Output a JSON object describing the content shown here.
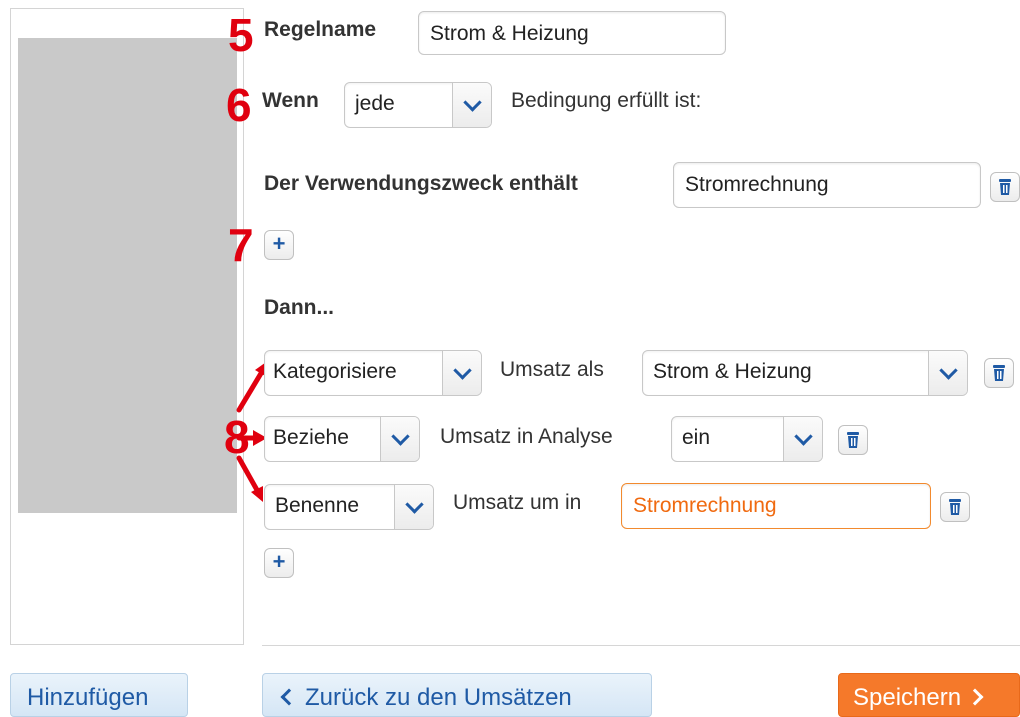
{
  "markers": {
    "m5": "5",
    "m6": "6",
    "m7": "7",
    "m8": "8"
  },
  "rule_name": {
    "label": "Regelname",
    "value": "Strom & Heizung"
  },
  "condition_mode": {
    "prefix": "Wenn",
    "selected": "jede",
    "suffix": "Bedingung erfüllt ist:"
  },
  "condition": {
    "label": "Der Verwendungszweck enthält",
    "value": "Stromrechnung"
  },
  "then_heading": "Dann...",
  "actions": [
    {
      "verb": "Kategorisiere",
      "text": "Umsatz als",
      "value": "Strom & Heizung"
    },
    {
      "verb": "Beziehe",
      "text": "Umsatz in Analyse",
      "value": "ein"
    },
    {
      "verb": "Benenne",
      "text": "Umsatz um in",
      "value": "Stromrechnung"
    }
  ],
  "icons": {
    "add": "plus-icon",
    "delete": "trash-icon",
    "dropdown": "chevron-down-icon",
    "back": "chevron-left-icon",
    "next": "chevron-right-icon"
  },
  "buttons": {
    "add_label": "Hinzufügen",
    "back_label": "Zurück zu den Umsätzen",
    "save_label": "Speichern"
  },
  "colors": {
    "accent_blue": "#1f5aa5",
    "save_orange": "#f5792a",
    "marker_red": "#e0000f",
    "input_highlight": "#f28a2e"
  }
}
